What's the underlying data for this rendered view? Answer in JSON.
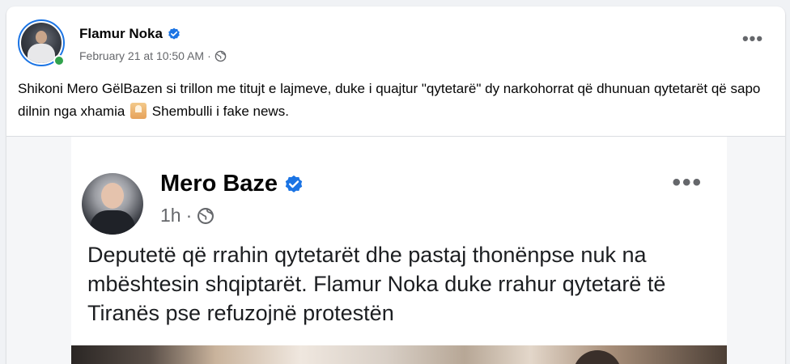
{
  "post": {
    "author": "Flamur Noka",
    "timestamp": "February 21 at 10:50 AM",
    "separator": "·",
    "audience_icon": "globe-icon",
    "more_label": "•••",
    "caption_part1": "Shikoni Mero GëlBazen si trillon me titujt e lajmeve, duke i quajtur \"qytetarë\" dy narkohorrat që dhunuan qytetarët që sapo dilnin nga xhamia",
    "caption_emoji": "mosque-emoji",
    "caption_part2": " Shembulli i fake news."
  },
  "embedded": {
    "author": "Mero Baze",
    "timestamp": "1h",
    "separator": "·",
    "audience_icon": "globe-icon",
    "more_label": "•••",
    "text": "Deputetë që rrahin qytetarët dhe pastaj thonënpse nuk na mbështesin shqiptarët. Flamur Noka duke rrahur qytetarë të Tiranës pse refuzojnë protestën"
  },
  "colors": {
    "verified": "#1b74e4",
    "online": "#31a24c",
    "meta_text": "#65676b"
  }
}
